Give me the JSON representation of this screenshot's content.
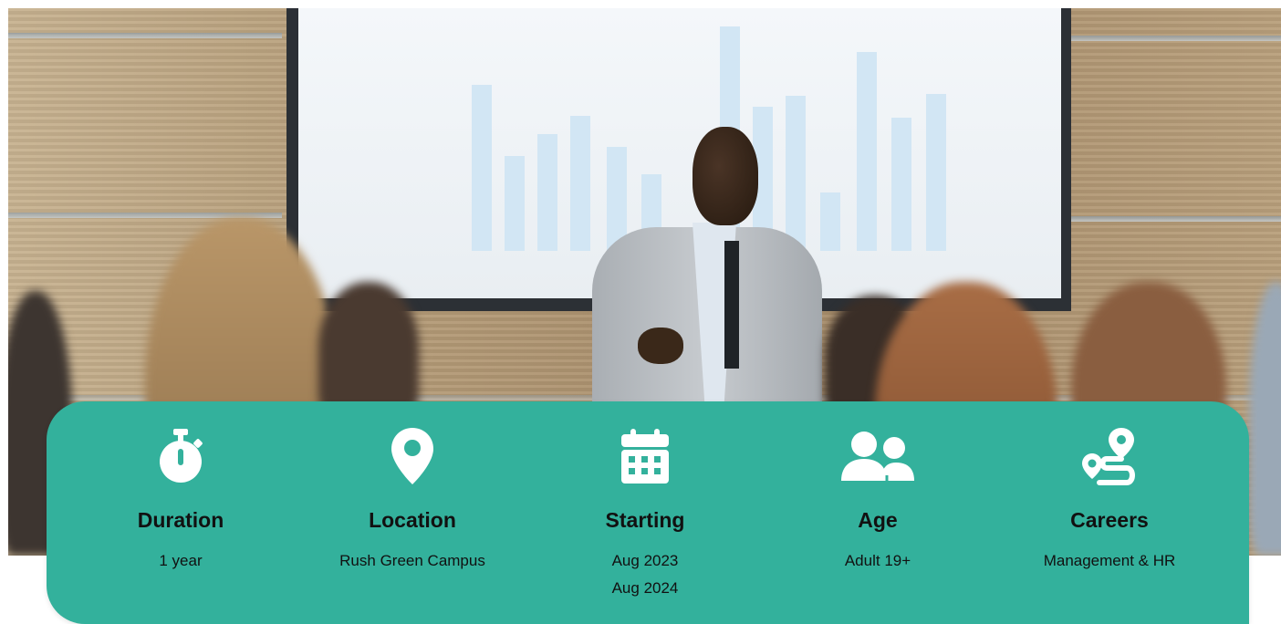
{
  "hero": {
    "image_description_icon": "presentation-photo"
  },
  "info_panel": {
    "background_color": "#33b19c",
    "items": [
      {
        "icon": "stopwatch-icon",
        "title": "Duration",
        "values": [
          "1 year"
        ]
      },
      {
        "icon": "map-pin-icon",
        "title": "Location",
        "values": [
          "Rush Green Campus"
        ]
      },
      {
        "icon": "calendar-icon",
        "title": "Starting",
        "values": [
          "Aug 2023",
          "Aug 2024"
        ]
      },
      {
        "icon": "users-icon",
        "title": "Age",
        "values": [
          "Adult 19+"
        ]
      },
      {
        "icon": "route-icon",
        "title": "Careers",
        "values": [
          "Management & HR"
        ]
      }
    ]
  }
}
